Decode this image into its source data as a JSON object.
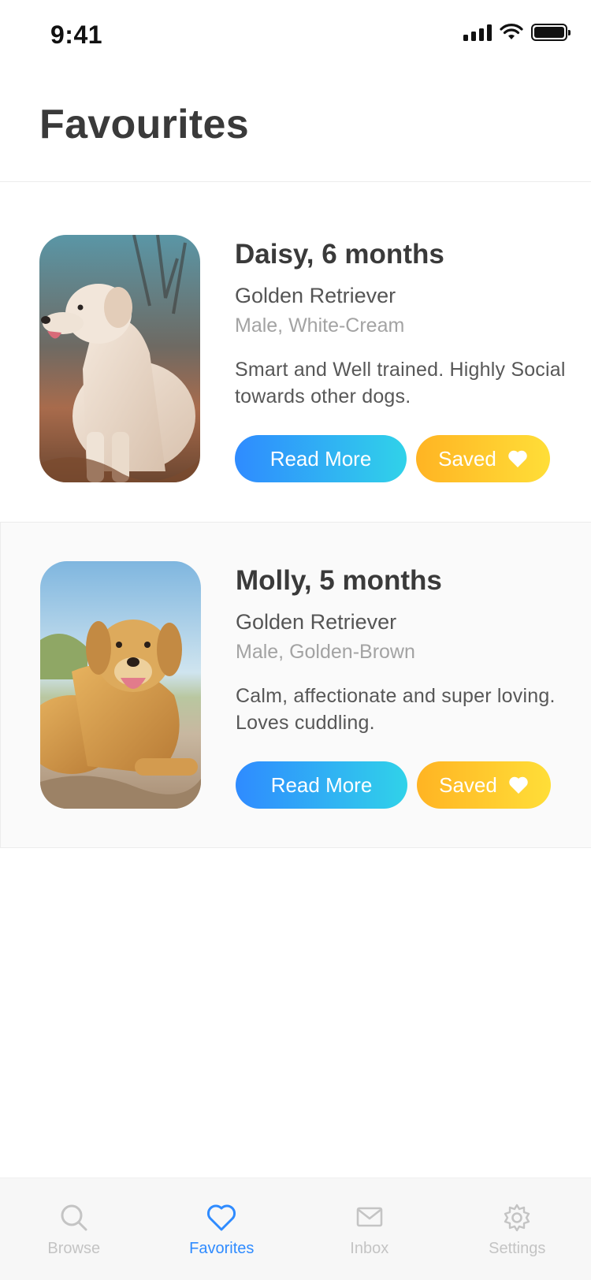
{
  "status_bar": {
    "time": "9:41",
    "battery_level": 1.0
  },
  "header": {
    "title": "Favourites"
  },
  "favorites": [
    {
      "name_age": "Daisy, 6 months",
      "breed": "Golden Retriever",
      "details": "Male, White-Cream",
      "description": "Smart and Well trained. Highly Social towards other dogs.",
      "read_more_label": "Read More",
      "saved_label": "Saved"
    },
    {
      "name_age": "Molly, 5 months",
      "breed": "Golden Retriever",
      "details": "Male, Golden-Brown",
      "description": "Calm, affectionate and super loving. Loves cuddling.",
      "read_more_label": "Read More",
      "saved_label": "Saved"
    }
  ],
  "tabs": [
    {
      "label": "Browse",
      "icon": "search-icon",
      "active": false
    },
    {
      "label": "Favorites",
      "icon": "heart-icon",
      "active": true
    },
    {
      "label": "Inbox",
      "icon": "mail-icon",
      "active": false
    },
    {
      "label": "Settings",
      "icon": "gear-icon",
      "active": false
    }
  ],
  "colors": {
    "accent_blue": "#2f8bff",
    "accent_cyan": "#30d2e9",
    "saved_orange": "#ffb423",
    "saved_yellow": "#ffde38",
    "tab_inactive": "#c4c4c4"
  }
}
